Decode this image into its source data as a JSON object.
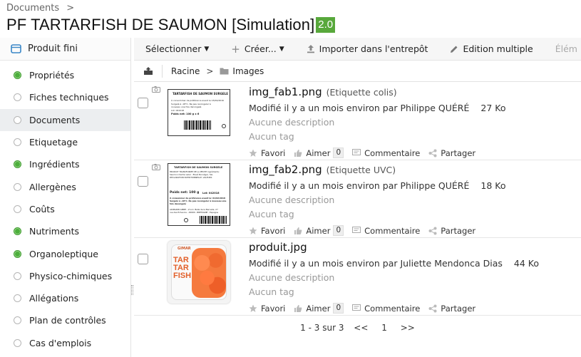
{
  "breadcrumb": {
    "root": "Documents",
    "separator": ">"
  },
  "title": "PF TARTARFISH DE SAUMON [Simulation]",
  "version": "2.0",
  "colors": {
    "version_badge": "#58a83b",
    "done_dot": "#4cae3c",
    "active_bg": "#eceef0"
  },
  "sidebar": {
    "header": "Produit fini",
    "items": [
      {
        "label": "Propriétés",
        "done": true
      },
      {
        "label": "Fiches techniques",
        "done": false
      },
      {
        "label": "Documents",
        "done": false,
        "active": true
      },
      {
        "label": "Etiquetage",
        "done": false
      },
      {
        "label": "Ingrédients",
        "done": true
      },
      {
        "label": "Allergènes",
        "done": false
      },
      {
        "label": "Coûts",
        "done": false
      },
      {
        "label": "Nutriments",
        "done": true
      },
      {
        "label": "Organoleptique",
        "done": true
      },
      {
        "label": "Physico-chimiques",
        "done": false
      },
      {
        "label": "Allégations",
        "done": false
      },
      {
        "label": "Plan de contrôles",
        "done": false
      },
      {
        "label": "Cas d'emplois",
        "done": false
      }
    ]
  },
  "toolbar": {
    "select_label": "Sélectionner",
    "create_label": "Créer...",
    "import_label": "Importer dans l'entrepôt",
    "edit_label": "Edition multiple",
    "more_label": "Élém"
  },
  "path": {
    "root": "Racine",
    "separator": ">",
    "folder": "Images"
  },
  "documents": [
    {
      "name": "img_fab1.png",
      "tag": "(Etiquette colis)",
      "modified": "Modifié il y a un mois environ par Philippe QUÉRÉ",
      "size": "27 Ko",
      "description": "Aucune description",
      "tags": "Aucun tag",
      "favorite_label": "Favori",
      "like_label": "Aimer",
      "like_count": "0",
      "comment_label": "Commentaire",
      "share_label": "Partager"
    },
    {
      "name": "img_fab2.png",
      "tag": "(Etiquette UVC)",
      "modified": "Modifié il y a un mois environ par Philippe QUÉRÉ",
      "size": "18 Ko",
      "description": "Aucune description",
      "tags": "Aucun tag",
      "favorite_label": "Favori",
      "like_label": "Aimer",
      "like_count": "0",
      "comment_label": "Commentaire",
      "share_label": "Partager"
    },
    {
      "name": "produit.jpg",
      "tag": "",
      "modified": "Modifié il y a un mois environ par Juliette Mendonca Dias",
      "size": "44 Ko",
      "description": "Aucune description",
      "tags": "Aucun tag",
      "favorite_label": "Favori",
      "like_label": "Aimer",
      "like_count": "0",
      "comment_label": "Commentaire",
      "share_label": "Partager"
    }
  ],
  "thumbnails": {
    "label1": {
      "heading": "TARTARFISH DE SAUMON SURGELE",
      "line1": "À consommer de préférence avant le 15/04/2016",
      "line2": "Surgelé à -18°C. Ne pas recongeler à nouveau une fois décongelé",
      "line3": "Lot: 041018",
      "line4": "Poids net: 100 g x 6"
    },
    "label2": {
      "heading": "TARTARFISH DE SAUMON SURGELE",
      "line1": "PRODUIT TRANSFORME DE LA PECHE Ingrédients:",
      "line2": "Saumon (Salmo salar - Elevé Norvège), Sel,",
      "line3": "DECLARATION NUTRITIONNELLE, VALEURS",
      "weight": "Poids net: 100 g",
      "lot": "Lot: 042018",
      "line4": "À consommer de préférence avant le: 01/02/2018",
      "line5": "Surgelé à -18°C. Ne pas recongeler à nouveau une fois décongelé",
      "line6": "AKIMARIN GMBH - Z.A.C. Belle de la Bernelle, 27",
      "line7": "rue des Echevins - 29900 - BRETAGNE - Espagne"
    },
    "product": {
      "brand": "GIMAR",
      "name_line1": "TAR",
      "name_line2": "TAR",
      "name_line3": "FISH"
    }
  },
  "pager": {
    "range": "1 - 3 sur 3",
    "prev": "<<",
    "page": "1",
    "next": ">>"
  }
}
